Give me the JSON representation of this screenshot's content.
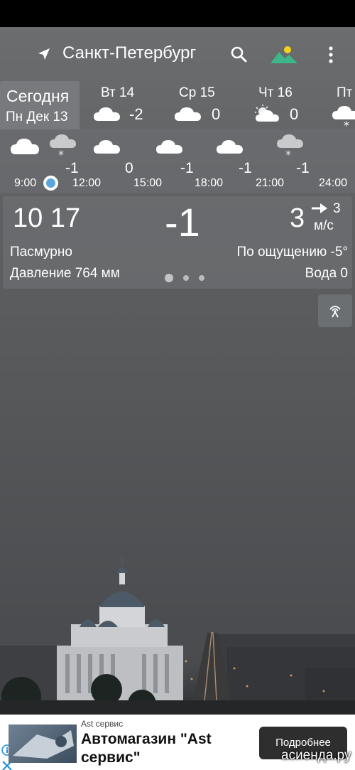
{
  "header": {
    "city": "Санкт-Петербург",
    "icons": [
      "location-arrow-icon",
      "search-icon",
      "landscape-icon",
      "more-vert-icon"
    ]
  },
  "days": {
    "today_title": "Сегодня",
    "today_date": "Пн Дек 13",
    "items": [
      {
        "name": "Вт 14",
        "temp": "-2",
        "icon": "cloud-icon"
      },
      {
        "name": "Ср 15",
        "temp": "0",
        "icon": "cloud-icon"
      },
      {
        "name": "Чт 16",
        "temp": "0",
        "icon": "partly-cloudy-icon"
      },
      {
        "name": "Пт",
        "temp": "",
        "icon": "snow-cloud-icon"
      }
    ]
  },
  "hourly": {
    "temps": [
      "-1",
      "0",
      "-1",
      "-1",
      "-1"
    ],
    "times": [
      "9:00",
      "12:00",
      "15:00",
      "18:00",
      "21:00",
      "24:00"
    ],
    "icons": [
      "cloud-icon",
      "snow-cloud-icon",
      "cloud-icon",
      "cloud-icon",
      "cloud-icon",
      "snow-cloud-icon"
    ]
  },
  "current": {
    "low_high": "10 17",
    "temp": "-1",
    "wind": "3",
    "gust": "3",
    "wind_unit": "м/с",
    "condition": "Пасмурно",
    "feels_like": "По ощущению -5°",
    "pressure": "Давление 764 мм",
    "water": "Вода 0",
    "page_dots": 3,
    "active_dot": 0
  },
  "ad": {
    "sponsor": "Ast сервис",
    "title": "Автомагазин \"Ast сервис\"",
    "button": "Подробнее"
  },
  "watermark": "асиенда.ру",
  "colors": {
    "sky": "#5f6163",
    "now_dot": "#5aa6dc",
    "landscape_sun": "#f2d21b",
    "landscape_hill": "#3fb58a",
    "ad_button": "#2e2e2e"
  }
}
